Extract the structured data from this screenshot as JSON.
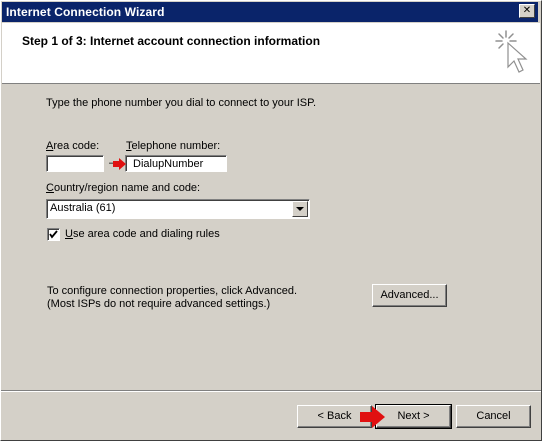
{
  "window": {
    "title": "Internet Connection Wizard",
    "close_glyph": "✕"
  },
  "header": {
    "step_title": "Step 1 of 3: Internet account connection information",
    "icon": "wizard-sparkle-cursor-icon"
  },
  "form": {
    "intro": "Type the phone number you dial to connect to your ISP.",
    "area_code_label": "Area code:",
    "area_code_value": "",
    "dash": "–",
    "telephone_label": "Telephone number:",
    "telephone_value": "DialupNumber",
    "country_label": "Country/region name and code:",
    "country_value": "Australia (61)",
    "use_rules_label": "Use area code and dialing rules",
    "use_rules_checked": true
  },
  "advanced": {
    "hint_line1": "To configure connection properties, click Advanced.",
    "hint_line2": "(Most ISPs do not require advanced settings.)",
    "button_label": "Advanced..."
  },
  "footer": {
    "back_label": "< Back",
    "next_label": "Next >",
    "cancel_label": "Cancel"
  },
  "colors": {
    "titlebar": "#0a246a",
    "face": "#d4d0c8",
    "highlight_arrow": "#e01010"
  }
}
